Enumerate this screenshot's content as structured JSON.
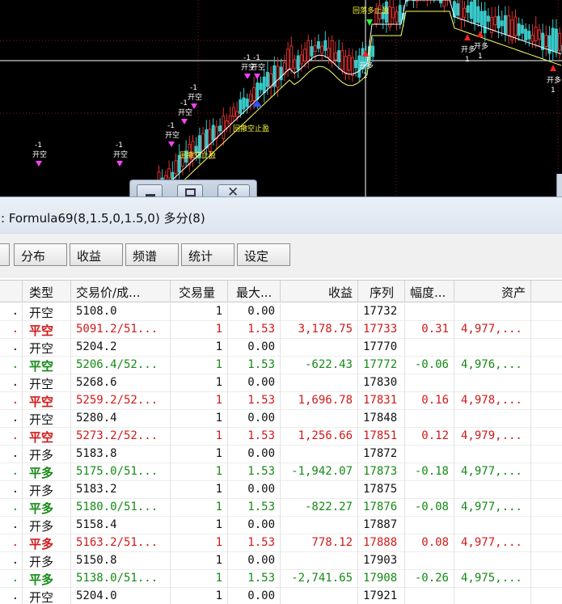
{
  "chart": {
    "bg_color": "#000000",
    "up_color": "#e03030",
    "down_color": "#38c8c8",
    "ma_color": "#ffffff",
    "ma2_color": "#ffff64",
    "signal_open_short_color": "#ff40ff",
    "signal_long_color": "#ff2020",
    "signal_green_color": "#30ff30",
    "signal_blue_color": "#3050ff",
    "labels": {
      "open_short": "开空",
      "open_long": "开多",
      "minus_one": "-1",
      "one": "1",
      "retrace_long_stop": "回撤多止盈",
      "retrace_short_stop": "回撤空止盈",
      "retrace_long_stop_2": "回落多止盈"
    }
  },
  "window_buttons": {
    "minimize": "minimize",
    "maximize": "maximize",
    "close": "close"
  },
  "formula_bar": {
    "text": ": Formula69(8,1.5,0,1.5,0) 多分(8)"
  },
  "toolbar": {
    "distribution": "分布",
    "profit": "收益",
    "spectrum": "频谱",
    "statistics": "统计",
    "settings": "设定"
  },
  "table": {
    "columns": [
      "类型",
      "交易价/成...",
      "交易量",
      "最大...",
      "收益",
      "序列",
      "幅度...",
      "资产"
    ],
    "rows": [
      {
        "lead": ".",
        "type": "开空",
        "price": "5108.0",
        "qty": "1",
        "max": "0.00",
        "profit": "",
        "seq": "17732",
        "amp": "",
        "asset": "",
        "kind": "open",
        "color": "black"
      },
      {
        "lead": ".",
        "type": "平空",
        "price": "5091.2/51...",
        "qty": "1",
        "max": "1.53",
        "profit": "3,178.75",
        "seq": "17733",
        "amp": "0.31",
        "asset": "4,977,...",
        "kind": "close",
        "color": "red"
      },
      {
        "lead": ".",
        "type": "开空",
        "price": "5204.2",
        "qty": "1",
        "max": "0.00",
        "profit": "",
        "seq": "17770",
        "amp": "",
        "asset": "",
        "kind": "open",
        "color": "black"
      },
      {
        "lead": ".",
        "type": "平空",
        "price": "5206.4/52...",
        "qty": "1",
        "max": "1.53",
        "profit": "-622.43",
        "seq": "17772",
        "amp": "-0.06",
        "asset": "4,976,...",
        "kind": "close",
        "color": "green"
      },
      {
        "lead": ".",
        "type": "开空",
        "price": "5268.6",
        "qty": "1",
        "max": "0.00",
        "profit": "",
        "seq": "17830",
        "amp": "",
        "asset": "",
        "kind": "open",
        "color": "black"
      },
      {
        "lead": ".",
        "type": "平空",
        "price": "5259.2/52...",
        "qty": "1",
        "max": "1.53",
        "profit": "1,696.78",
        "seq": "17831",
        "amp": "0.16",
        "asset": "4,978,...",
        "kind": "close",
        "color": "red"
      },
      {
        "lead": ".",
        "type": "开空",
        "price": "5280.4",
        "qty": "1",
        "max": "0.00",
        "profit": "",
        "seq": "17848",
        "amp": "",
        "asset": "",
        "kind": "open",
        "color": "black"
      },
      {
        "lead": ".",
        "type": "平空",
        "price": "5273.2/52...",
        "qty": "1",
        "max": "1.53",
        "profit": "1,256.66",
        "seq": "17851",
        "amp": "0.12",
        "asset": "4,979,...",
        "kind": "close",
        "color": "red"
      },
      {
        "lead": ".",
        "type": "开多",
        "price": "5183.8",
        "qty": "1",
        "max": "0.00",
        "profit": "",
        "seq": "17872",
        "amp": "",
        "asset": "",
        "kind": "open",
        "color": "black"
      },
      {
        "lead": ".",
        "type": "平多",
        "price": "5175.0/51...",
        "qty": "1",
        "max": "1.53",
        "profit": "-1,942.07",
        "seq": "17873",
        "amp": "-0.18",
        "asset": "4,977,...",
        "kind": "close",
        "color": "green"
      },
      {
        "lead": ".",
        "type": "开多",
        "price": "5183.2",
        "qty": "1",
        "max": "0.00",
        "profit": "",
        "seq": "17875",
        "amp": "",
        "asset": "",
        "kind": "open",
        "color": "black"
      },
      {
        "lead": ".",
        "type": "平多",
        "price": "5180.0/51...",
        "qty": "1",
        "max": "1.53",
        "profit": "-822.27",
        "seq": "17876",
        "amp": "-0.08",
        "asset": "4,977,...",
        "kind": "close",
        "color": "green"
      },
      {
        "lead": ".",
        "type": "开多",
        "price": "5158.4",
        "qty": "1",
        "max": "0.00",
        "profit": "",
        "seq": "17887",
        "amp": "",
        "asset": "",
        "kind": "open",
        "color": "black"
      },
      {
        "lead": ".",
        "type": "平多",
        "price": "5163.2/51...",
        "qty": "1",
        "max": "1.53",
        "profit": "778.12",
        "seq": "17888",
        "amp": "0.08",
        "asset": "4,977,...",
        "kind": "close",
        "color": "red"
      },
      {
        "lead": ".",
        "type": "开多",
        "price": "5150.8",
        "qty": "1",
        "max": "0.00",
        "profit": "",
        "seq": "17903",
        "amp": "",
        "asset": "",
        "kind": "open",
        "color": "black"
      },
      {
        "lead": ".",
        "type": "平多",
        "price": "5138.0/51...",
        "qty": "1",
        "max": "1.53",
        "profit": "-2,741.65",
        "seq": "17908",
        "amp": "-0.26",
        "asset": "4,975,...",
        "kind": "close",
        "color": "green"
      },
      {
        "lead": ".",
        "type": "开空",
        "price": "5204.0",
        "qty": "1",
        "max": "0.00",
        "profit": "",
        "seq": "17921",
        "amp": "",
        "asset": "",
        "kind": "open",
        "color": "black"
      }
    ]
  }
}
